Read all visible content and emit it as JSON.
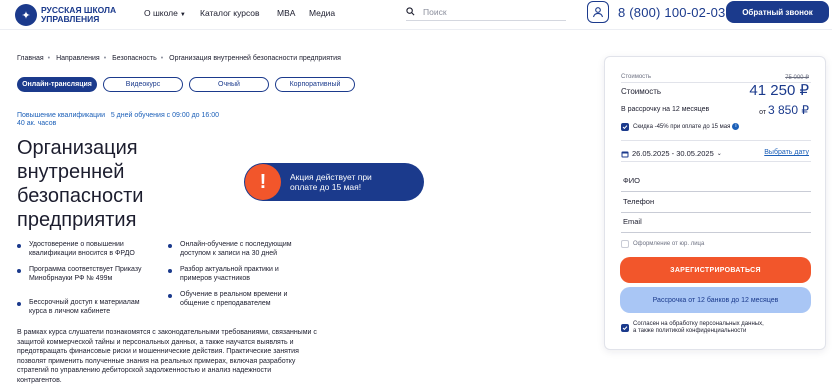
{
  "header": {
    "logo_text": "РУССКАЯ ШКОЛА УПРАВЛЕНИЯ",
    "nav": [
      "О школе",
      "Каталог курсов",
      "MBA",
      "Медиа"
    ],
    "search_placeholder": "Поиск",
    "phone": "8 (800) 100-02-03",
    "callback_label": "Обратный звонок"
  },
  "breadcrumb": [
    "Главная",
    "Направления",
    "Безопасность",
    "Организация внутренней безопасности предприятия"
  ],
  "tabs": [
    "Онлайн-трансляция",
    "Видеокурс",
    "Очный",
    "Корпоративный"
  ],
  "meta": {
    "type": "Повышение квалификации",
    "schedule": "5 дней обучения с 09:00 до 16:00",
    "hours": "40 ак. часов"
  },
  "title": "Организация внутренней безопасности предприятия",
  "promo": {
    "icon": "!",
    "text": "Акция действует при оплате до 15 мая!"
  },
  "features": [
    "Удостоверение о повышении квалификации вносится в ФРДО",
    "Онлайн-обучение с последующим доступом к записи на 30 дней",
    "Программа соответствует Приказу Минобрнауки РФ № 499м",
    "Разбор актуальной практики и примеров участников",
    "Бессрочный доступ к материалам курса в личном кабинете",
    "Обучение в реальном времени и общение с преподавателем"
  ],
  "description": "В рамках курса слушатели познакомятся с законодательными требованиями, связанными с защитой коммерческой тайны и персональных данных, а также научатся выявлять и предотвращать финансовые риски и мошеннические действия. Практические занятия позволят применить полученные знания на реальных примерах, включая разработку стратегий по управлению дебиторской задолженностью и анализ надежности контрагентов.",
  "card": {
    "old_cost_label": "Стоимость",
    "old_price": "75 000 ₽",
    "cost_label": "Стоимость",
    "price": "41 250 ₽",
    "installment_label": "В рассрочку на 12 месяцев",
    "installment_prefix": "от",
    "installment_price": "3 850 ₽",
    "discount_text": "Скидка -45% при оплате до 15 мая",
    "dates": "26.05.2025 - 30.05.2025",
    "choose_date": "Выбрать дату",
    "fields": [
      "ФИО",
      "Телефон",
      "Email"
    ],
    "legal_entity": "Оформление от юр. лица",
    "register_label": "ЗАРЕГИСТРИРОВАТЬСЯ",
    "bank_label": "Рассрочка от 12 банков до 12 месяцев",
    "agree_line1": "Согласен на обработку персональных данных,",
    "agree_line2": "а также политикой конфиденциальности"
  }
}
